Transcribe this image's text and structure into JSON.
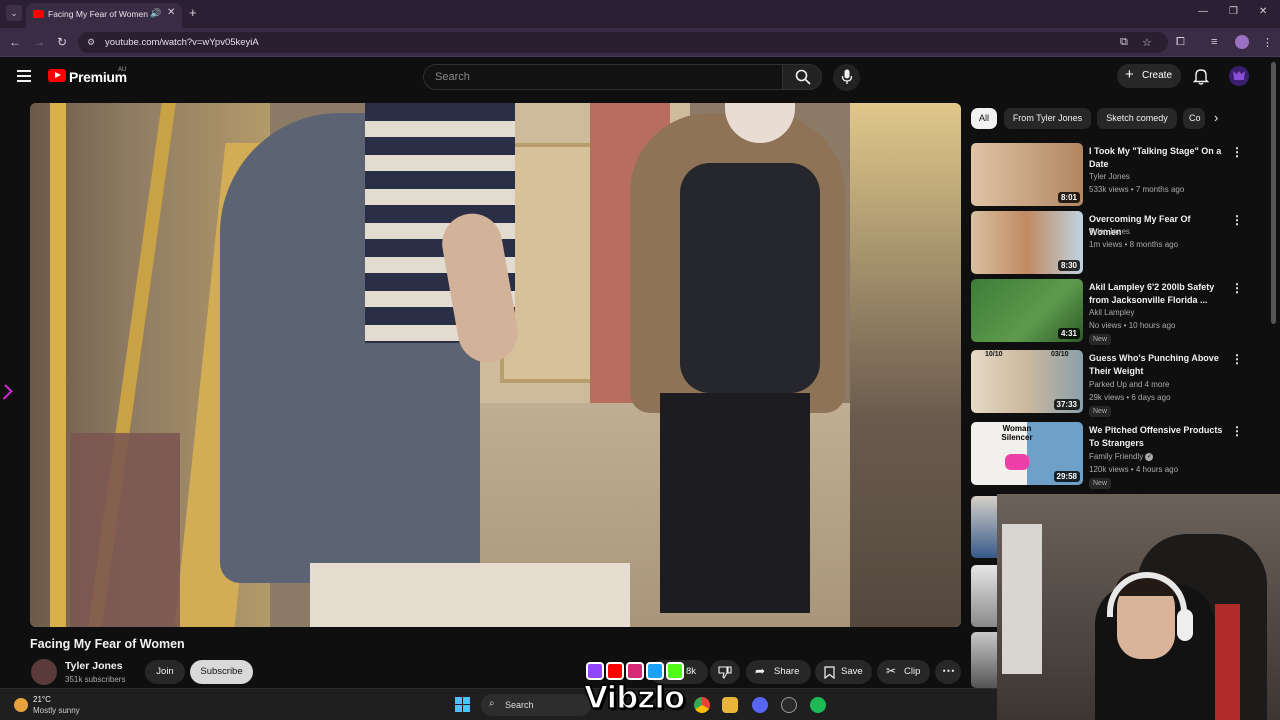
{
  "browser": {
    "tab_title": "Facing My Fear of Women",
    "url": "youtube.com/watch?v=wYpv05keyiA"
  },
  "header": {
    "brand": "Premium",
    "region": "AU",
    "search_placeholder": "Search",
    "create_label": "Create"
  },
  "video": {
    "title": "Facing My Fear of Women",
    "channel": "Tyler Jones",
    "subscribers": "351k subscribers",
    "join_label": "Join",
    "subscribe_label": "Subscribe",
    "likes": "8k",
    "share_label": "Share",
    "save_label": "Save",
    "clip_label": "Clip"
  },
  "chips": [
    "All",
    "From Tyler Jones",
    "Sketch comedy",
    "Co"
  ],
  "related": [
    {
      "title": "I Took My \"Talking Stage\" On a Date",
      "channel": "Tyler Jones",
      "meta": "533k views • 7 months ago",
      "duration": "8:01",
      "new": false,
      "thumb_color": "#c9a27a"
    },
    {
      "title": "Overcoming My Fear Of Women",
      "channel": "Tyler Jones",
      "meta": "1m views • 8 months ago",
      "duration": "8:30",
      "new": false,
      "thumb_color": "#d7b98e"
    },
    {
      "title": "Akil Lampley 6'2 200lb Safety from Jacksonville Florida ...",
      "channel": "Akil Lampley",
      "meta": "No views • 10 hours ago",
      "duration": "4:31",
      "new": true,
      "new_label": "New",
      "thumb_color": "#3f7d3a"
    },
    {
      "title": "Guess Who's Punching Above Their Weight",
      "channel": "Parked Up and 4 more",
      "meta": "29k views • 6 days ago",
      "duration": "37:33",
      "new": true,
      "new_label": "New",
      "thumb_color": "#d8cbb8",
      "thumb_text_left": "10/10",
      "thumb_text_right": "03/10"
    },
    {
      "title": "We Pitched Offensive Products To Strangers",
      "channel": "Family Friendly",
      "meta": "120k views • 4 hours ago",
      "duration": "29:58",
      "new": true,
      "new_label": "New",
      "thumb_color": "#6fa0c8",
      "thumb_text_left": "Woman Silencer"
    }
  ],
  "taskbar": {
    "temperature": "21°C",
    "condition": "Mostly sunny",
    "search_label": "Search"
  },
  "overlay": {
    "brand_text": "Vibzlo"
  },
  "colors": {
    "yt_red": "#ff0000",
    "background": "#0f0f0f",
    "chrome": "#3a2c44"
  }
}
